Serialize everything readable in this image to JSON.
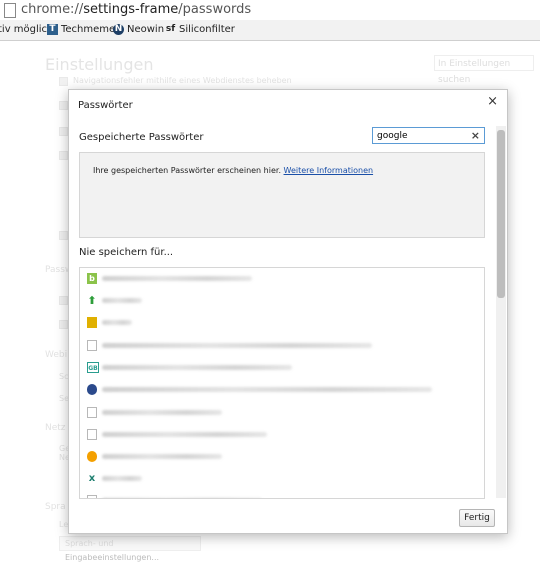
{
  "browser": {
    "url_prefix": "chrome://",
    "url_host": "settings-frame",
    "url_path": "/passwords"
  },
  "bookmarks": [
    {
      "label": "tiv möglich",
      "icon": "none"
    },
    {
      "label": "Techmeme",
      "icon": "techmeme-icon"
    },
    {
      "label": "Neowin",
      "icon": "neowin-icon"
    },
    {
      "label": "Siliconfilter",
      "icon": "siliconfilter-icon"
    }
  ],
  "settings": {
    "title": "Einstellungen",
    "search_placeholder": "In Einstellungen suchen",
    "first_option": "Navigationsfehler mithilfe eines Webdienstes beheben",
    "section_labels": [
      "Passw",
      "Webi",
      "Netz",
      "Spra"
    ],
    "fragments": [
      "Sc",
      "Se",
      "Ge",
      "Ne",
      "Le"
    ],
    "language_button": "Sprach- und Eingabeeinstellungen..."
  },
  "dialog": {
    "title": "Passwörter",
    "saved_passwords_label": "Gespeicherte Passwörter",
    "filter_value": "google",
    "saved_message": "Ihre gespeicherten Passwörter erscheinen hier.",
    "more_info_link": "Weitere Informationen",
    "never_saved_label": "Nie speichern für...",
    "done_button": "Fertig",
    "close_symbol": "×",
    "clear_symbol": "×"
  },
  "never_saved_rows": [
    {
      "icon": "site-b-icon",
      "icon_color": "#8bc34a"
    },
    {
      "icon": "green-arrow-icon",
      "icon_color": "#2e9e3a"
    },
    {
      "icon": "yellow-logo-icon",
      "icon_color": "#e0b000"
    },
    {
      "icon": "file-icon",
      "icon_color": "#ffffff"
    },
    {
      "icon": "gb-logo-icon",
      "icon_color": "#2a9d8f"
    },
    {
      "icon": "blue-circle-icon",
      "icon_color": "#2b4a8c"
    },
    {
      "icon": "file-icon",
      "icon_color": "#ffffff"
    },
    {
      "icon": "file-icon",
      "icon_color": "#ffffff"
    },
    {
      "icon": "orange-flower-icon",
      "icon_color": "#f4a000"
    },
    {
      "icon": "xing-icon",
      "icon_color": "#1d7f6f"
    },
    {
      "icon": "file-icon",
      "icon_color": "#ffffff"
    }
  ]
}
